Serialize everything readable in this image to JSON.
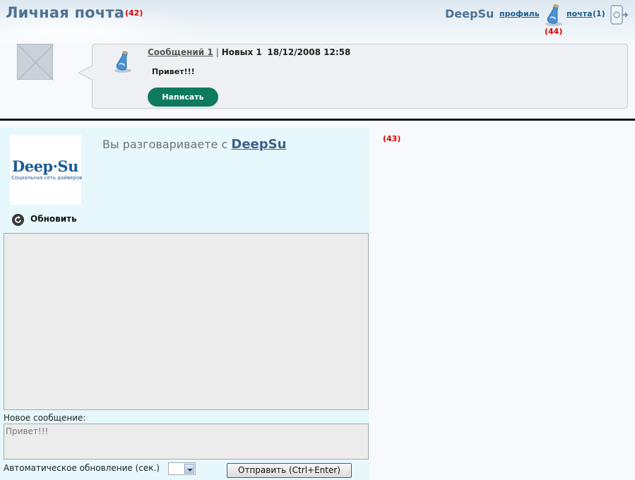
{
  "header": {
    "title": "Личная почта",
    "marker_title": "(42)",
    "username": "DeepSu",
    "profile_link": "профиль",
    "mail_link": "почта",
    "mail_count": "(1)",
    "marker_mail": "(44)"
  },
  "notification": {
    "messages_label": "Сообщений 1",
    "separator": "|",
    "new_label": "Новых 1",
    "datetime": "18/12/2008 12:58",
    "preview": "Привет!!!",
    "write_button": "Написать"
  },
  "conversation": {
    "marker": "(43)",
    "logo_text": "Deep·Su",
    "logo_subtitle": "Социальная сеть дайверов",
    "talking_with_prefix": "Вы разговариваете с",
    "talking_with_name": "DeepSu",
    "refresh_label": "Обновить",
    "new_message_label": "Новое сообщение:",
    "new_message_value": "Привет!!!",
    "auto_refresh_label": "Автоматическое обновление (сек.)",
    "send_button": "Отправить (Ctrl+Enter)"
  },
  "icons": {
    "bottle": "bottle-mail-icon",
    "exit": "exit-icon",
    "refresh": "refresh-icon"
  },
  "colors": {
    "accent": "#0e7a5e",
    "title": "#4d7294",
    "link": "#1f5a8a",
    "panel": "#e6f8fc",
    "marker": "#e00000"
  }
}
